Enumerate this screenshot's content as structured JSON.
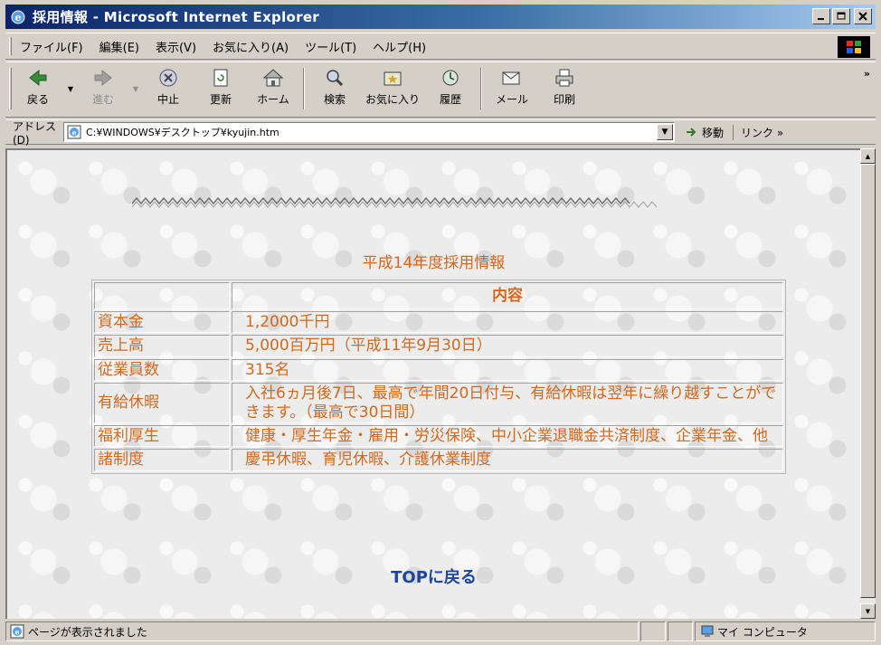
{
  "window": {
    "title": "採用情報 - Microsoft Internet Explorer",
    "buttons": [
      "minimize-icon",
      "maximize-icon",
      "close-icon"
    ]
  },
  "menu": {
    "items": [
      "ファイル(F)",
      "編集(E)",
      "表示(V)",
      "お気に入り(A)",
      "ツール(T)",
      "ヘルプ(H)"
    ]
  },
  "toolbar": {
    "back": "戻る",
    "forward": "進む",
    "stop": "中止",
    "refresh": "更新",
    "home": "ホーム",
    "search": "検索",
    "favorites": "お気に入り",
    "history": "履歴",
    "mail": "メール",
    "print": "印刷",
    "overflow": "»"
  },
  "address": {
    "label": "アドレス(D)",
    "value": "C:¥WINDOWS¥デスクトップ¥kyujin.htm",
    "go": "移動",
    "links": "リンク »"
  },
  "page": {
    "heading": "平成14年度採用情報",
    "table": {
      "header_item": "",
      "header_content": "内容",
      "rows": [
        {
          "item": "資本金",
          "value": "1,2000千円"
        },
        {
          "item": "売上高",
          "value": "5,000百万円（平成11年9月30日）"
        },
        {
          "item": "従業員数",
          "value": "315名"
        },
        {
          "item": "有給休暇",
          "value": "入社6ヵ月後7日、最高で年間20日付与、有給休暇は翌年に繰り越すことができます。（最高で30日間）"
        },
        {
          "item": "福利厚生",
          "value": "健康・厚生年金・雇用・労災保険、中小企業退職金共済制度、企業年金、他"
        },
        {
          "item": "諸制度",
          "value": "慶弔休暇、育児休暇、介護休業制度"
        }
      ]
    },
    "top_link": "TOPに戻る"
  },
  "status": {
    "text": "ページが表示されました",
    "zone": "マイ コンピュータ"
  },
  "colors": {
    "content_text": "#d2691e",
    "link": "#1e46a0",
    "titlebar": "#0a246a"
  }
}
